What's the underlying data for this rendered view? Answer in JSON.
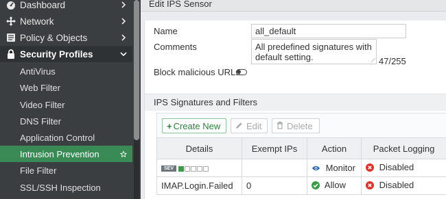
{
  "sidebar": {
    "top_items": [
      {
        "label": "Dashboard",
        "icon": "dashboard-icon"
      },
      {
        "label": "Network",
        "icon": "network-icon"
      },
      {
        "label": "Policy & Objects",
        "icon": "policy-icon"
      },
      {
        "label": "Security Profiles",
        "icon": "lock-icon"
      }
    ],
    "sub_items": [
      {
        "label": "AntiVirus"
      },
      {
        "label": "Web Filter"
      },
      {
        "label": "Video Filter"
      },
      {
        "label": "DNS Filter"
      },
      {
        "label": "Application Control"
      },
      {
        "label": "Intrusion Prevention"
      },
      {
        "label": "File Filter"
      },
      {
        "label": "SSL/SSH Inspection"
      }
    ]
  },
  "page": {
    "title": "Edit IPS Sensor"
  },
  "form": {
    "name_label": "Name",
    "name_value": "all_default",
    "comments_label": "Comments",
    "comments_value": "All predefined signatures with default setting.",
    "comments_count": "47/255",
    "block_label": "Block malicious URLs",
    "block_enabled": false
  },
  "section": {
    "title": "IPS Signatures and Filters"
  },
  "toolbar": {
    "create_label": "Create New",
    "edit_label": "Edit",
    "delete_label": "Delete"
  },
  "table": {
    "headers": [
      "Details",
      "Exempt IPs",
      "Action",
      "Packet Logging"
    ],
    "rows": [
      {
        "sev_label": "SEV",
        "details": "",
        "exempt": "",
        "action": "Monitor",
        "logging": "Disabled"
      },
      {
        "sev_label": "",
        "details": "IMAP.Login.Failed",
        "exempt": "0",
        "action": "Allow",
        "logging": "Disabled"
      }
    ]
  },
  "colors": {
    "sidebar_bg": "#3b3e40",
    "selected_green": "#3a8a55",
    "create_green": "#2e7d3d",
    "monitor_blue": "#1f5fa8",
    "allow_green": "#3c9a4a",
    "disabled_red": "#d9342b"
  }
}
